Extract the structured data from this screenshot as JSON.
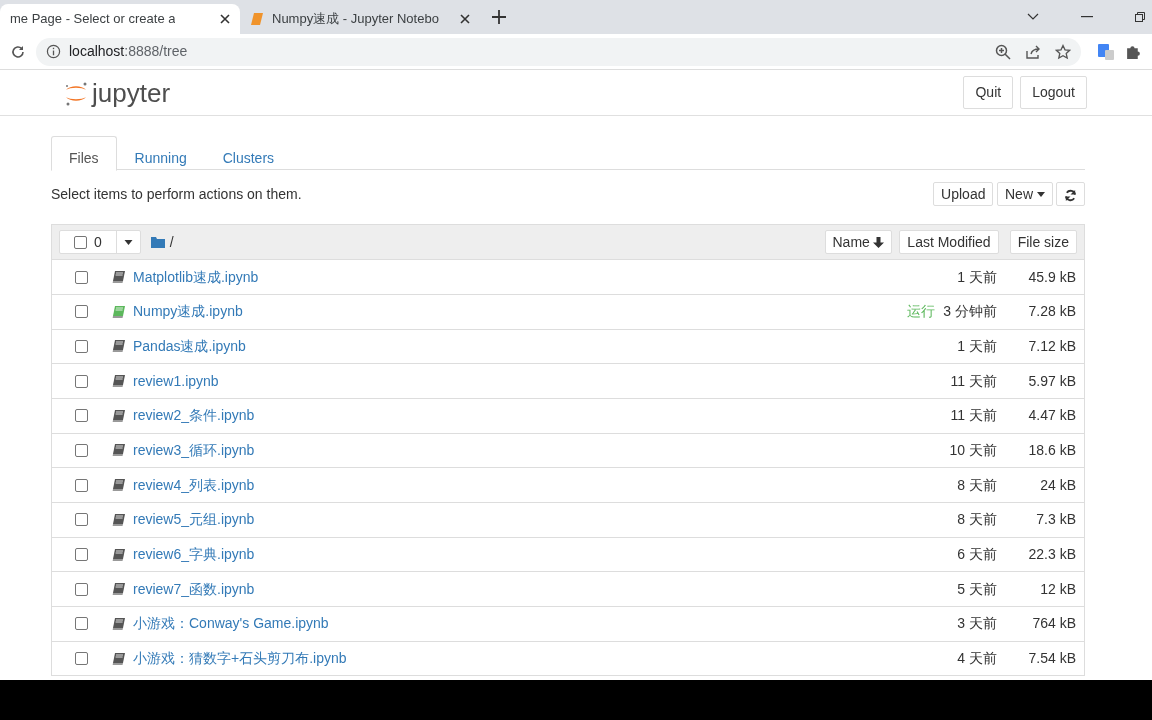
{
  "browser": {
    "tabs": [
      {
        "title": "me Page - Select or create a",
        "selected": true
      },
      {
        "title": "Numpy速成 - Jupyter Notebo",
        "selected": false
      }
    ],
    "address": {
      "host": "localhost",
      "path": ":8888/tree"
    }
  },
  "header": {
    "brand": "jupyter",
    "buttons": [
      "Quit",
      "Logout"
    ]
  },
  "tabs": [
    {
      "label": "Files",
      "selected": true
    },
    {
      "label": "Running",
      "selected": false
    },
    {
      "label": "Clusters",
      "selected": false
    }
  ],
  "hint": "Select items to perform actions on them.",
  "actions": {
    "upload": "Upload",
    "new": "New"
  },
  "list_header": {
    "count": "0",
    "path": "/",
    "checked": false,
    "columns": [
      "Name",
      "Last Modified",
      "File size"
    ]
  },
  "files": [
    {
      "name": "Matplotlib速成.ipynb",
      "running": false,
      "modified": "1 天前",
      "size": "45.9 kB",
      "checked": false
    },
    {
      "name": "Numpy速成.ipynb",
      "running": true,
      "status": "运行",
      "modified": "3 分钟前",
      "size": "7.28 kB",
      "checked": false
    },
    {
      "name": "Pandas速成.ipynb",
      "running": false,
      "modified": "1 天前",
      "size": "7.12 kB",
      "checked": false
    },
    {
      "name": "review1.ipynb",
      "running": false,
      "modified": "11 天前",
      "size": "5.97 kB",
      "checked": false
    },
    {
      "name": "review2_条件.ipynb",
      "running": false,
      "modified": "11 天前",
      "size": "4.47 kB",
      "checked": false
    },
    {
      "name": "review3_循环.ipynb",
      "running": false,
      "modified": "10 天前",
      "size": "18.6 kB",
      "checked": false
    },
    {
      "name": "review4_列表.ipynb",
      "running": false,
      "modified": "8 天前",
      "size": "24 kB",
      "checked": false
    },
    {
      "name": "review5_元组.ipynb",
      "running": false,
      "modified": "8 天前",
      "size": "7.3 kB",
      "checked": false
    },
    {
      "name": "review6_字典.ipynb",
      "running": false,
      "modified": "6 天前",
      "size": "22.3 kB",
      "checked": false
    },
    {
      "name": "review7_函数.ipynb",
      "running": false,
      "modified": "5 天前",
      "size": "12 kB",
      "checked": false
    },
    {
      "name": "小游戏：Conway's Game.ipynb",
      "running": false,
      "modified": "3 天前",
      "size": "764 kB",
      "checked": false
    },
    {
      "name": "小游戏：猜数字+石头剪刀布.ipynb",
      "running": false,
      "modified": "4 天前",
      "size": "7.54 kB",
      "checked": false
    }
  ]
}
